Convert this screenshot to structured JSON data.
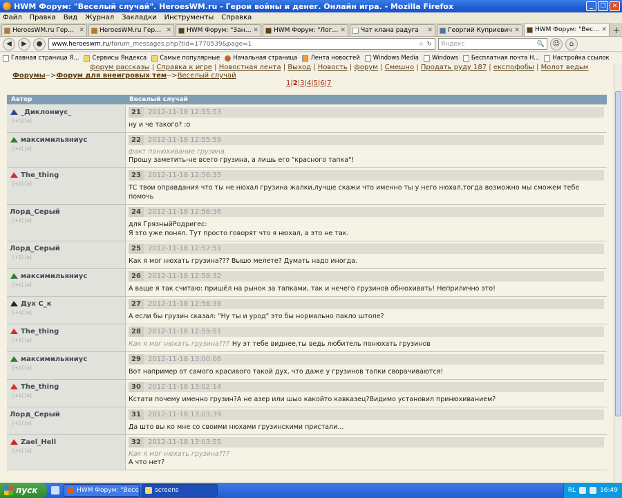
{
  "window": {
    "title": "HWM Форум: \"Веселый случай\". HeroesWM.ru - Герои войны и денег. Онлайн игра. - Mozilla Firefox"
  },
  "menu": [
    "Файл",
    "Правка",
    "Вид",
    "Журнал",
    "Закладки",
    "Инструменты",
    "Справка"
  ],
  "tabs": [
    {
      "label": "HeroesWM.ru Герои войн...",
      "icon_color": "#b87a2a",
      "active": false
    },
    {
      "label": "HeroesWM.ru Герои войн...",
      "icon_color": "#b87a2a",
      "active": false
    },
    {
      "label": "HWM Форум: \"Занюхать\"...",
      "icon_color": "#5a3f18",
      "active": false
    },
    {
      "label": "HWM Форум: \"Логическо...",
      "icon_color": "#5a3f18",
      "active": false
    },
    {
      "label": "Чат клана радуга",
      "icon_color": "#ffffff",
      "active": false
    },
    {
      "label": "Георгий Куприевич",
      "icon_color": "#4a76a8",
      "active": false
    },
    {
      "label": "HWM Форум: \"Веселый с...",
      "icon_color": "#5a3f18",
      "active": true
    }
  ],
  "navbar": {
    "url_domain": "www.heroeswm.ru",
    "url_path": "/forum_messages.php?tid=1770539&page=1",
    "search_placeholder": "Яндекс"
  },
  "bookmarks": [
    {
      "label": "Главная страница Я...",
      "icon": "page-icon"
    },
    {
      "label": "Сервисы Яндекса",
      "icon": "folder-icon"
    },
    {
      "label": "Самые популярные",
      "icon": "folder-icon"
    },
    {
      "label": "Начальная страница",
      "icon": "firefox-icon"
    },
    {
      "label": "Лента новостей",
      "icon": "rss-icon"
    },
    {
      "label": "Windows Media",
      "icon": "page-icon"
    },
    {
      "label": "Windows",
      "icon": "page-icon"
    },
    {
      "label": "Бесплатная почта H...",
      "icon": "page-icon"
    },
    {
      "label": "Настройка ссылок",
      "icon": "page-icon"
    }
  ],
  "page": {
    "topnav": [
      "форум рассказы",
      "Справка к игре",
      "Новостная лента",
      "Выход",
      "Новость",
      "форум",
      "Смешно",
      "Продать руду 187",
      "експофобы",
      "Молот ведьм"
    ],
    "crumbs": {
      "forums": "Форумы",
      "sep": "-->",
      "section": "Форум для внеигровых тем",
      "topic": "Веселый случай"
    },
    "pages": [
      "1",
      "2",
      "3",
      "4",
      "5",
      "6",
      "7"
    ],
    "current_page": "2",
    "header": {
      "author": "Автор",
      "topic": "Веселый случай"
    }
  },
  "posts": [
    {
      "author": "_Диклониус_",
      "clan_color": "#2a4a8a",
      "meta": "[+1] [a]",
      "num": "21",
      "date": "2012-11-18 12:55:53",
      "quote": "",
      "message": "ну и че такого? :о",
      "inline": false
    },
    {
      "author": "максимильяниус",
      "clan_color": "#2e7d32",
      "meta": "[+1] [a]",
      "num": "22",
      "date": "2012-11-18 12:55:59",
      "quote": "факт понюхивание грузина.",
      "message": "Прошу заметить-не всего грузина, а лишь его \"красного тапка\"!",
      "inline": false
    },
    {
      "author": "The_thing",
      "clan_color": "#d32f2f",
      "meta": "[+1] [a]",
      "num": "23",
      "date": "2012-11-18 12:56:35",
      "quote": "",
      "message": "ТС твои оправдания что ты не нюхал грузина жалки,лучше скажи что именно ты у него нюхал,тогда возможно мы сможем тебе помочь",
      "inline": false
    },
    {
      "author": "Лорд_Серый",
      "clan_color": "",
      "meta": "[+1] [a]",
      "num": "24",
      "date": "2012-11-18 12:56:36",
      "quote": "",
      "message": "для ГрязныйРодригес:\nЯ это уже понял. Тут просто говорят что я нюхал, а это не так.",
      "inline": false
    },
    {
      "author": "Лорд_Серый",
      "clan_color": "",
      "meta": "[+1] [a]",
      "num": "25",
      "date": "2012-11-18 12:57:51",
      "quote": "",
      "message": "Как я мог нюхать грузина??? Вышо мелете? Думать надо иногда.",
      "inline": false
    },
    {
      "author": "максимильяниус",
      "clan_color": "#2e7d32",
      "meta": "[+1] [a]",
      "num": "26",
      "date": "2012-11-18 12:58:32",
      "quote": "",
      "message": "А ваще я так считаю: пришёл на рынок за тапками, так и нечего грузинов обнюхивать! Неприлично это!",
      "inline": false
    },
    {
      "author": "Дух С_к",
      "clan_color": "#222222",
      "meta": "[+1] [a]",
      "num": "27",
      "date": "2012-11-18 12:58:38",
      "quote": "",
      "message": "А если бы грузин сказал: \"Ну ты и урод\" это бы нормально пакло штоле?",
      "inline": false
    },
    {
      "author": "The_thing",
      "clan_color": "#d32f2f",
      "meta": "[+1] [a]",
      "num": "28",
      "date": "2012-11-18 12:59:51",
      "quote": "Как я мог нюхать грузина???",
      "message": "Ну эт тебе виднее,ты ведь любитель понюхать грузинов",
      "inline": true
    },
    {
      "author": "максимильяниус",
      "clan_color": "#2e7d32",
      "meta": "[+1] [a]",
      "num": "29",
      "date": "2012-11-18 13:00:06",
      "quote": "",
      "message": "Вот например от самого красивого такой дух, что даже у грузинов тапки сворачиваются!",
      "inline": false
    },
    {
      "author": "The_thing",
      "clan_color": "#d32f2f",
      "meta": "[+1] [a]",
      "num": "30",
      "date": "2012-11-18 13:02:14",
      "quote": "",
      "message": "Кстати почему именно грузин?А не азер или шыо какойто кавказец?Видимо установил принюхиванием?",
      "inline": false
    },
    {
      "author": "Лорд_Серый",
      "clan_color": "",
      "meta": "[+1] [a]",
      "num": "31",
      "date": "2012-11-18 13:03:39",
      "quote": "",
      "message": "Да што вы ко мне со своими нюхами грузинскими пристали...",
      "inline": false
    },
    {
      "author": "Zael_Hell",
      "clan_color": "#c62828",
      "meta": "[+1] [a]",
      "num": "32",
      "date": "2012-11-18 13:03:55",
      "quote": "Как я мог нюхать грузина???",
      "message": "А что нет?",
      "inline": false
    }
  ],
  "taskbar": {
    "start_label": "пуск",
    "tasks": [
      {
        "label": "HWM Форум: \"Весел...",
        "icon_color": "#e25d10",
        "pressed": true
      },
      {
        "label": "screens",
        "icon_color": "#f4d66c",
        "pressed": false
      }
    ],
    "tray_lang": "RL",
    "clock": "16:49"
  },
  "colors": {
    "forum_header": "#7f9db3",
    "link_brown": "#5a3f18",
    "pager_red": "#a0280a"
  }
}
